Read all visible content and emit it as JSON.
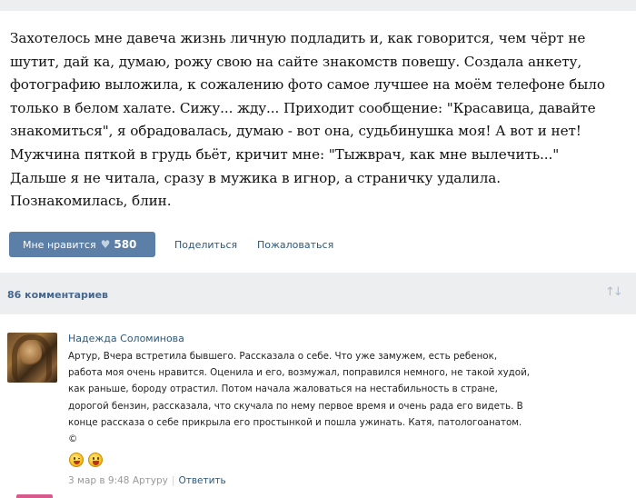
{
  "post": {
    "lines": [
      "Захотелось мне давеча жизнь личную подладить и, как говорится, чем чёрт не",
      "шутит, дай ка, думаю, рожу свою на сайте знакомств повешу. Создала анкету,",
      "фотографию выложила, к сожалению фото самое лучшее на моём телефоне было",
      "только в белом халате. Сижу... жду... Приходит сообщение: \"Красавица, давайте",
      "знакомиться\", я обрадовалась, думаю - вот она, судьбинушка моя! А вот и нет!",
      "Мужчина пяткой в грудь бьёт, кричит мне: \"Тыжврач, как мне вылечить...\"",
      "Дальше я не читала, сразу в мужика в игнор, а страничку удалила.",
      "Познакомилась, блин."
    ],
    "like_label": "Мне нравится",
    "like_icon": "heart-icon",
    "like_count": "580",
    "share_label": "Поделиться",
    "report_label": "Пожаловаться"
  },
  "comments_bar": {
    "count_label": "86 комментариев",
    "sort_icon": "sort-arrows-icon"
  },
  "comment": {
    "author": "Надежда Соломинова",
    "lines": [
      "Артур, Вчера встретила бывшего. Рассказала о себе. Что уже замужем, есть ребенок,",
      "работа моя очень нравится. Оценила и его, возмужал, поправился немного, не такой худой,",
      "как раньше, бороду отрастил. Потом начала жаловаться на нестабильность в стране,",
      "дорогой бензин, рассказала, что скучала по нему первое время и очень рада его видеть. В",
      "конце рассказа о себе прикрыла его простынкой и пошла ужинать. Катя, патологоанатом.",
      "©"
    ],
    "emojis": [
      "wink-emoji",
      "laughing-emoji"
    ],
    "date": "3 мар в 9:48 Артуру",
    "reply_label": "Ответить"
  },
  "colors": {
    "accent": "#5b7fa6",
    "link": "#2b587a",
    "background": "#edeef0"
  }
}
